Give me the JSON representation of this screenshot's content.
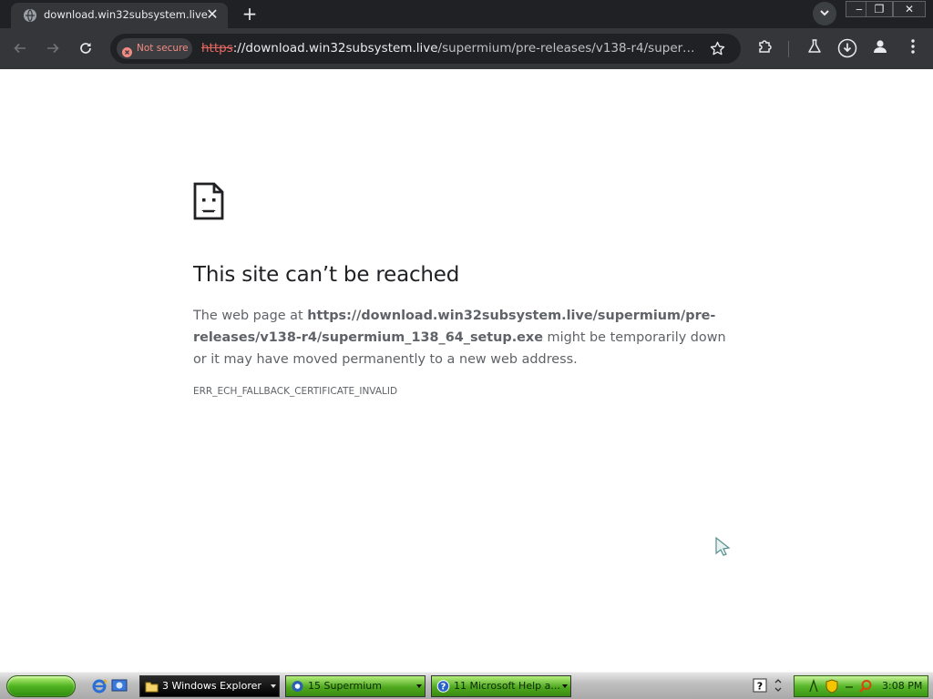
{
  "browser": {
    "tab": {
      "title": "download.win32subsystem.live"
    },
    "omnibox": {
      "security_chip": "Not secure",
      "url_scheme": "https",
      "url_host": "://download.win32subsystem.live",
      "url_path": "/supermium/pre-releases/v138-r4/supermium_1..."
    },
    "icons": {
      "back": "arrow-left-icon",
      "forward": "arrow-right-icon",
      "reload": "reload-icon",
      "bookmark": "star-icon",
      "extensions": "puzzle-icon",
      "labs": "flask-icon",
      "downloads": "download-icon",
      "profile": "person-icon",
      "menu": "kebab-menu-icon"
    },
    "colors": {
      "titlebar": "#202124",
      "toolbar": "#35363a",
      "not_secure": "#f28b82"
    }
  },
  "error_page": {
    "title": "This site can’t be reached",
    "desc_prefix": "The web page at ",
    "desc_url": "https://download.win32subsystem.live/supermium/pre-releases/v138-r4/supermium_138_64_setup.exe",
    "desc_suffix": " might be temporarily down or it may have moved permanently to a new web address.",
    "error_code": "ERR_ECH_FALLBACK_CERTIFICATE_INVALID"
  },
  "taskbar": {
    "tasks": [
      {
        "label": "3 Windows Explorer"
      },
      {
        "label": "15 Supermium"
      },
      {
        "label": "11 Microsoft Help a..."
      }
    ],
    "clock": "3:08 PM"
  }
}
